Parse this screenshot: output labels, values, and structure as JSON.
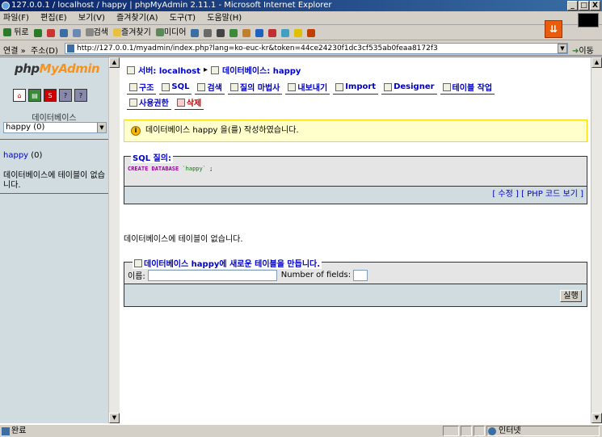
{
  "window": {
    "title": "127.0.0.1 / localhost / happy | phpMyAdmin 2.11.1 - Microsoft Internet Explorer",
    "min": "_",
    "max": "□",
    "close": "X"
  },
  "menu": [
    "파일(F)",
    "편집(E)",
    "보기(V)",
    "즐겨찾기(A)",
    "도구(T)",
    "도움말(H)"
  ],
  "toolbar": {
    "back": "뒤로",
    "search": "검색",
    "favorites": "즐겨찾기",
    "media": "미디어"
  },
  "address": {
    "label": "주소(D)",
    "links_label": "연결 »",
    "url": "http://127.0.0.1/myadmin/index.php?lang=ko-euc-kr&token=44ce24230f1dc3cf535ab0feaa8172f3",
    "go": "이동"
  },
  "sidebar": {
    "logo_php": "php",
    "logo_myadmin": "MyAdmin",
    "db_label": "데이터베이스",
    "db_selected": "happy (0)",
    "db_name": "happy",
    "db_count": "(0)",
    "no_tables": "데이터베이스에 테이블이 없습니다."
  },
  "breadcrumb": {
    "server": "서버: localhost",
    "database": "데이터베이스: happy"
  },
  "tabs_row1": [
    {
      "label": "구조",
      "name": "tab-structure"
    },
    {
      "label": "SQL",
      "name": "tab-sql"
    },
    {
      "label": "검색",
      "name": "tab-search"
    },
    {
      "label": "질의 마법사",
      "name": "tab-query"
    },
    {
      "label": "내보내기",
      "name": "tab-export"
    },
    {
      "label": "Import",
      "name": "tab-import"
    },
    {
      "label": "Designer",
      "name": "tab-designer"
    },
    {
      "label": "테이블 작업",
      "name": "tab-operations"
    }
  ],
  "tabs_row2": [
    {
      "label": "사용권한",
      "name": "tab-privileges"
    },
    {
      "label": "삭제",
      "name": "tab-drop"
    }
  ],
  "notice": "데이터베이스 happy 을(를) 작성하였습니다.",
  "sql": {
    "legend": "SQL 질의:",
    "keyword": "CREATE DATABASE",
    "name": "`happy`",
    "end": ";",
    "edit": "수정",
    "php_code": "PHP 코드 보기"
  },
  "main_no_tables": "데이터베이스에 테이블이 없습니다.",
  "create": {
    "legend": "데이터베이스 happy에 새로운 테이블을 만듭니다.",
    "name_label": "이름:",
    "fields_label": "Number of fields:",
    "run": "실행"
  },
  "status": {
    "text": "완료",
    "zone": "인터넷"
  }
}
